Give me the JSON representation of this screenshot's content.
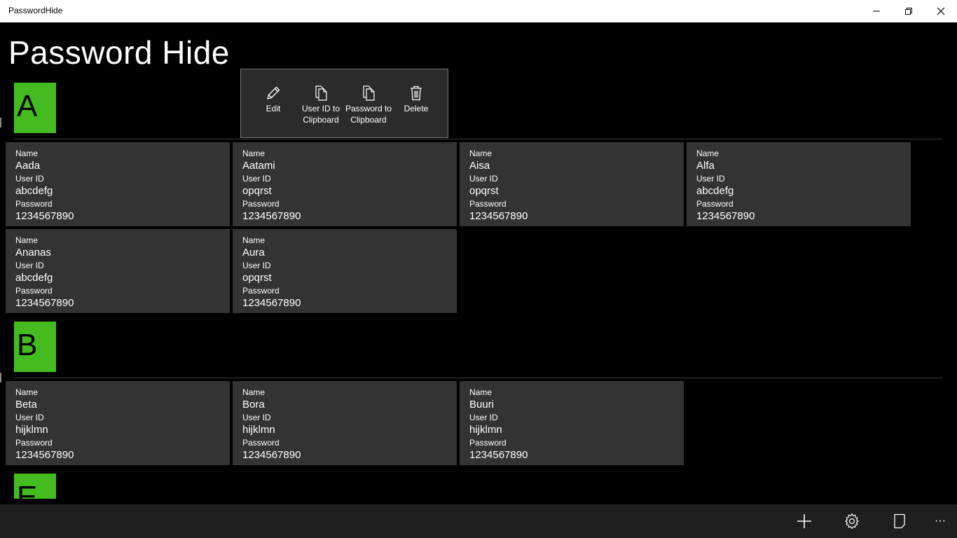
{
  "window": {
    "title": "PasswordHide"
  },
  "app": {
    "heading": "Password Hide"
  },
  "field_labels": {
    "name": "Name",
    "user_id": "User ID",
    "password": "Password"
  },
  "groups": [
    {
      "letter": "A",
      "entries": [
        {
          "name": "Aada",
          "user_id": "abcdefg",
          "password": "1234567890"
        },
        {
          "name": "Aatami",
          "user_id": "opqrst",
          "password": "1234567890"
        },
        {
          "name": "Aisa",
          "user_id": "opqrst",
          "password": "1234567890"
        },
        {
          "name": "Alfa",
          "user_id": "abcdefg",
          "password": "1234567890"
        },
        {
          "name": "Ananas",
          "user_id": "abcdefg",
          "password": "1234567890"
        },
        {
          "name": "Aura",
          "user_id": "opqrst",
          "password": "1234567890"
        }
      ]
    },
    {
      "letter": "B",
      "entries": [
        {
          "name": "Beta",
          "user_id": "hijklmn",
          "password": "1234567890"
        },
        {
          "name": "Bora",
          "user_id": "hijklmn",
          "password": "1234567890"
        },
        {
          "name": "Buuri",
          "user_id": "hijklmn",
          "password": "1234567890"
        }
      ]
    },
    {
      "letter": "E",
      "entries": []
    }
  ],
  "context_menu": {
    "edit": "Edit",
    "userid_copy_line1": "User ID to",
    "userid_copy_line2": "Clipboard",
    "password_copy_line1": "Password to",
    "password_copy_line2": "Clipboard",
    "delete": "Delete"
  },
  "app_bar": {
    "icons": [
      "add-icon",
      "settings-icon",
      "page-icon"
    ],
    "more": "···"
  },
  "colors": {
    "accent": "#44bb1f",
    "card_bg": "#333333",
    "flyout_bg": "#2b2b2b",
    "app_bar_bg": "#1f1f1f"
  }
}
